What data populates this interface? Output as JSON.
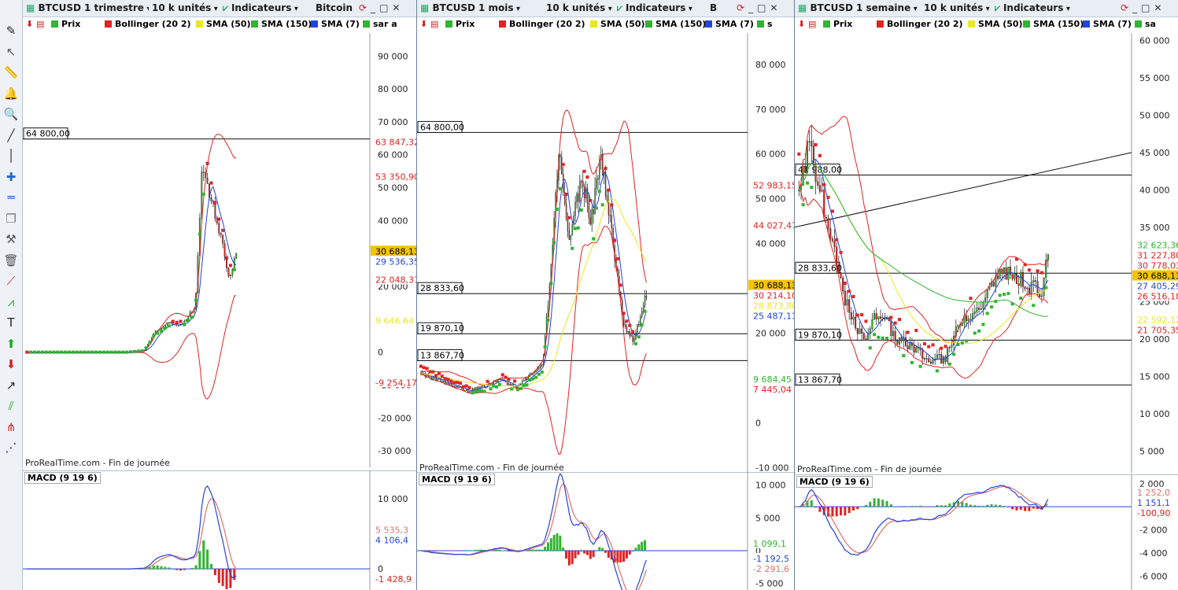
{
  "toolbar_icons": [
    "pen-icon",
    "cursor-icon",
    "ruler-icon",
    "alarm-bell-icon",
    "zoom-icon",
    "line-tool-icon",
    "vertical-line-icon",
    "crosshair-icon",
    "horizontal-line-icon",
    "duplicate-icon",
    "tools-icon",
    "trash-icon",
    "trend-channel-icon",
    "fibonacci-icon",
    "text-icon",
    "buy-arrow-icon",
    "sell-arrow-icon",
    "ray-icon",
    "parallel-lines-icon",
    "andrews-pitchfork-icon",
    "gann-fan-icon"
  ],
  "colors": {
    "up": "#2fb52f",
    "down": "#e32222",
    "bollinger": "#e32222",
    "sma50": "#e8e820",
    "sma150": "#2fb52f",
    "sma7": "#2244dd",
    "sar_up": "#2fb52f",
    "sar_down": "#e32222",
    "macd_line": "#2244dd",
    "signal": "#e07070"
  },
  "panes": [
    {
      "symbol": "BTCUSD",
      "period": "1 trimestre",
      "units": "10 k unités",
      "indicators_label": "Indicateurs",
      "extra": "Bitcoin",
      "legend": [
        "Prix",
        "Bollinger (20 2)",
        "SMA (50)",
        "SMA (150)",
        "SMA (7)",
        "sar a"
      ],
      "footer": "ProRealTime.com - Fin de journée",
      "macd_label": "MACD (9 19 6)",
      "price_axis": {
        "min": -35000,
        "max": 97000,
        "ticks": [
          "90 000",
          "80 000",
          "70 000",
          "60 000",
          "50 000",
          "40 000",
          "30 000",
          "20 000",
          "10 000",
          "0",
          "-10 000",
          "-20 000",
          "-30 000"
        ],
        "tick_values": [
          90000,
          80000,
          70000,
          60000,
          50000,
          40000,
          30000,
          20000,
          10000,
          0,
          -10000,
          -20000,
          -30000
        ]
      },
      "hlines": [
        {
          "label": "64 800,00",
          "value": 64800
        }
      ],
      "tags": [
        {
          "text": "63 847,32",
          "value": 63847.32,
          "color": "#e32222"
        },
        {
          "text": "53 350,90",
          "value": 53350.9,
          "color": "#e32222"
        },
        {
          "text": "30 688,13",
          "value": 30688.13,
          "color": "#f5c400"
        },
        {
          "text": "29 536,35",
          "value": 29536.35,
          "color": "#2244dd"
        },
        {
          "text": "22 048,37",
          "value": 22048.37,
          "color": "#e32222"
        },
        {
          "text": "9 646,64",
          "value": 9646.64,
          "color": "#e8e820"
        },
        {
          "text": "-9 254,17",
          "value": -9254.17,
          "color": "#e32222"
        }
      ],
      "macd_axis": {
        "ticks": [
          "10 000",
          "0"
        ],
        "tick_values": [
          10000,
          0
        ],
        "min": -3000,
        "max": 14000
      },
      "macd_tags": [
        {
          "text": "5 535,3",
          "value": 5535.3,
          "color": "#e07070"
        },
        {
          "text": "4 106,4",
          "value": 4106.4,
          "color": "#2244dd"
        },
        {
          "text": "-1 428,9",
          "value": -1428.9,
          "color": "#e32222"
        }
      ]
    },
    {
      "symbol": "BTCUSD",
      "period": "1 mois",
      "units": "10 k unités",
      "indicators_label": "Indicateurs",
      "extra": "B",
      "legend": [
        "Prix",
        "Bollinger (20 2)",
        "SMA (50)",
        "SMA (150)",
        "SMA (7)",
        "s"
      ],
      "footer": "ProRealTime.com - Fin de journée",
      "macd_label": "MACD (9 19 6)",
      "price_axis": {
        "min": -11000,
        "max": 87000,
        "ticks": [
          "80 000",
          "70 000",
          "60 000",
          "50 000",
          "40 000",
          "30 000",
          "20 000",
          "10 000",
          "0",
          "-10 000"
        ],
        "tick_values": [
          80000,
          70000,
          60000,
          50000,
          40000,
          30000,
          20000,
          10000,
          0,
          -10000
        ]
      },
      "hlines": [
        {
          "label": "64 800,00",
          "value": 64800
        },
        {
          "label": "28 833,60",
          "value": 28833.6
        },
        {
          "label": "19 870,10",
          "value": 19870.1
        },
        {
          "label": "13 867,70",
          "value": 13867.7
        }
      ],
      "tags": [
        {
          "text": "52 983,15",
          "value": 52983.15,
          "color": "#e32222"
        },
        {
          "text": "44 027,47",
          "value": 44027.47,
          "color": "#e32222"
        },
        {
          "text": "30 688,13",
          "value": 30688.13,
          "color": "#f5c400"
        },
        {
          "text": "30 214,10",
          "value": 30214.1,
          "color": "#e32222"
        },
        {
          "text": "28 873,80",
          "value": 28873.8,
          "color": "#e8e820"
        },
        {
          "text": "25 487,13",
          "value": 25487.13,
          "color": "#2244dd"
        },
        {
          "text": "9 684,45",
          "value": 9684.45,
          "color": "#2fb52f"
        },
        {
          "text": "7 445,04",
          "value": 7445.04,
          "color": "#e32222"
        }
      ],
      "macd_axis": {
        "ticks": [
          "10 000",
          "5 000",
          "0",
          "-5 000"
        ],
        "tick_values": [
          10000,
          5000,
          0,
          -5000
        ],
        "min": -6000,
        "max": 12000
      },
      "macd_tags": [
        {
          "text": "1 099,1",
          "value": 1099.1,
          "color": "#2fb52f"
        },
        {
          "text": "-1 192,5",
          "value": -1192.5,
          "color": "#2244dd"
        },
        {
          "text": "-2 291,6",
          "value": -2291.6,
          "color": "#e07070"
        }
      ]
    },
    {
      "symbol": "BTCUSD",
      "period": "1 semaine",
      "units": "10 k unités",
      "indicators_label": "Indicateurs",
      "extra": "",
      "legend": [
        "Prix",
        "Bollinger (20 2)",
        "SMA (50)",
        "SMA (150)",
        "SMA (7)",
        "sa"
      ],
      "footer": "ProRealTime.com - Fin de journée",
      "macd_label": "MACD (9 19 6)",
      "price_axis": {
        "min": 2000,
        "max": 61000,
        "ticks": [
          "60 000",
          "55 000",
          "50 000",
          "45 000",
          "40 000",
          "35 000",
          "30 000",
          "25 000",
          "20 000",
          "15 000",
          "10 000",
          "5 000"
        ],
        "tick_values": [
          60000,
          55000,
          50000,
          45000,
          40000,
          35000,
          30000,
          25000,
          20000,
          15000,
          10000,
          5000
        ]
      },
      "hlines": [
        {
          "label": "41 988,00",
          "value": 41988
        },
        {
          "label": "28 833,60",
          "value": 28833.6
        },
        {
          "label": "19 870,10",
          "value": 19870.1
        },
        {
          "label": "13 867,70",
          "value": 13867.7
        }
      ],
      "tags": [
        {
          "text": "32 623,36",
          "value": 32623.36,
          "color": "#2fb52f"
        },
        {
          "text": "31 227,80",
          "value": 31227.8,
          "color": "#e32222"
        },
        {
          "text": "30 778,03",
          "value": 30778.03,
          "color": "#e32222"
        },
        {
          "text": "30 688,13",
          "value": 30688.13,
          "color": "#f5c400"
        },
        {
          "text": "27 405,29",
          "value": 27405.29,
          "color": "#2244dd"
        },
        {
          "text": "26 516,18",
          "value": 26516.18,
          "color": "#e32222"
        },
        {
          "text": "22 592,12",
          "value": 22592.12,
          "color": "#e8e820"
        },
        {
          "text": "21 705,35",
          "value": 21705.35,
          "color": "#e32222"
        }
      ],
      "macd_axis": {
        "ticks": [
          "2 000",
          "0",
          "-2 000",
          "-4 000",
          "-6 000"
        ],
        "tick_values": [
          2000,
          0,
          -2000,
          -4000,
          -6000
        ],
        "min": -7200,
        "max": 2800
      },
      "macd_tags": [
        {
          "text": "1 252,0",
          "value": 1252,
          "color": "#e07070"
        },
        {
          "text": "1 151,1",
          "value": 1151.1,
          "color": "#2244dd"
        },
        {
          "text": "-100,90",
          "value": -100.9,
          "color": "#e32222"
        }
      ]
    }
  ]
}
